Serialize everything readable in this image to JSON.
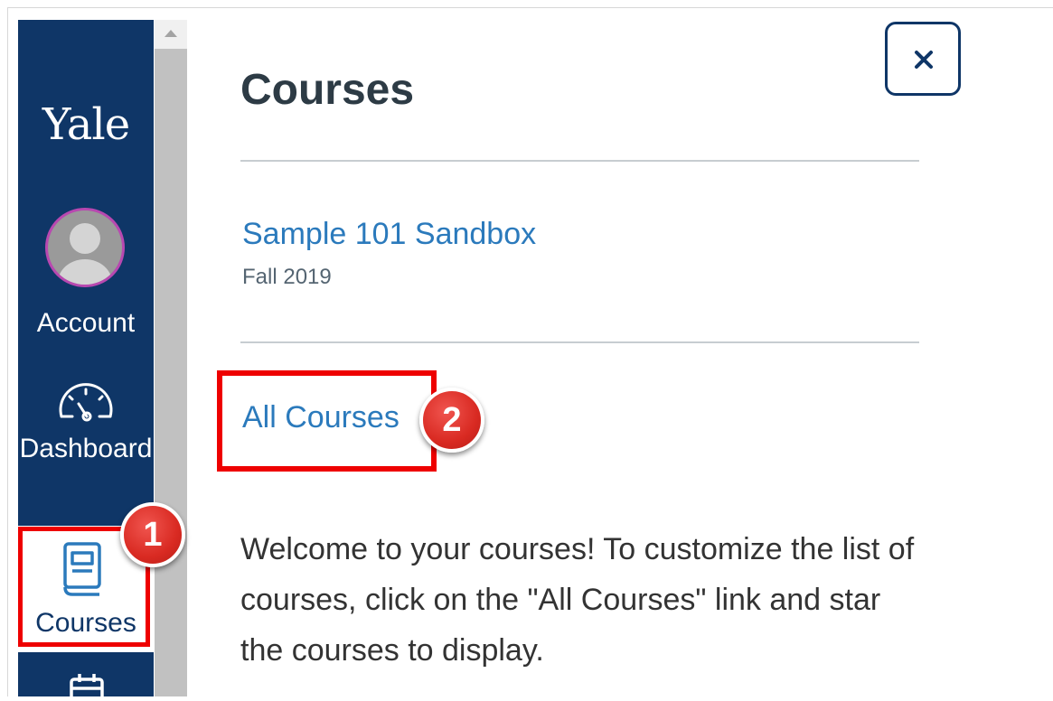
{
  "sidebar": {
    "logo": "Yale",
    "background_color": "#0f3667",
    "items": [
      {
        "label": "Account",
        "icon": "avatar"
      },
      {
        "label": "Dashboard",
        "icon": "dashboard-gauge-icon"
      },
      {
        "label": "Courses",
        "icon": "courses-book-icon",
        "active": true
      },
      {
        "label": "",
        "icon": "calendar-icon"
      }
    ]
  },
  "tray": {
    "title": "Courses",
    "close_icon": "close-icon",
    "courses": [
      {
        "name": "Sample 101 Sandbox",
        "term": "Fall 2019"
      }
    ],
    "all_courses_label": "All Courses",
    "welcome_text": "Welcome to your courses! To customize the list of courses, click on the \"All Courses\" link and star the courses to display.",
    "link_color": "#2b7abc"
  },
  "annotations": {
    "step1": "1",
    "step2": "2",
    "highlight_color": "#ee0000"
  }
}
